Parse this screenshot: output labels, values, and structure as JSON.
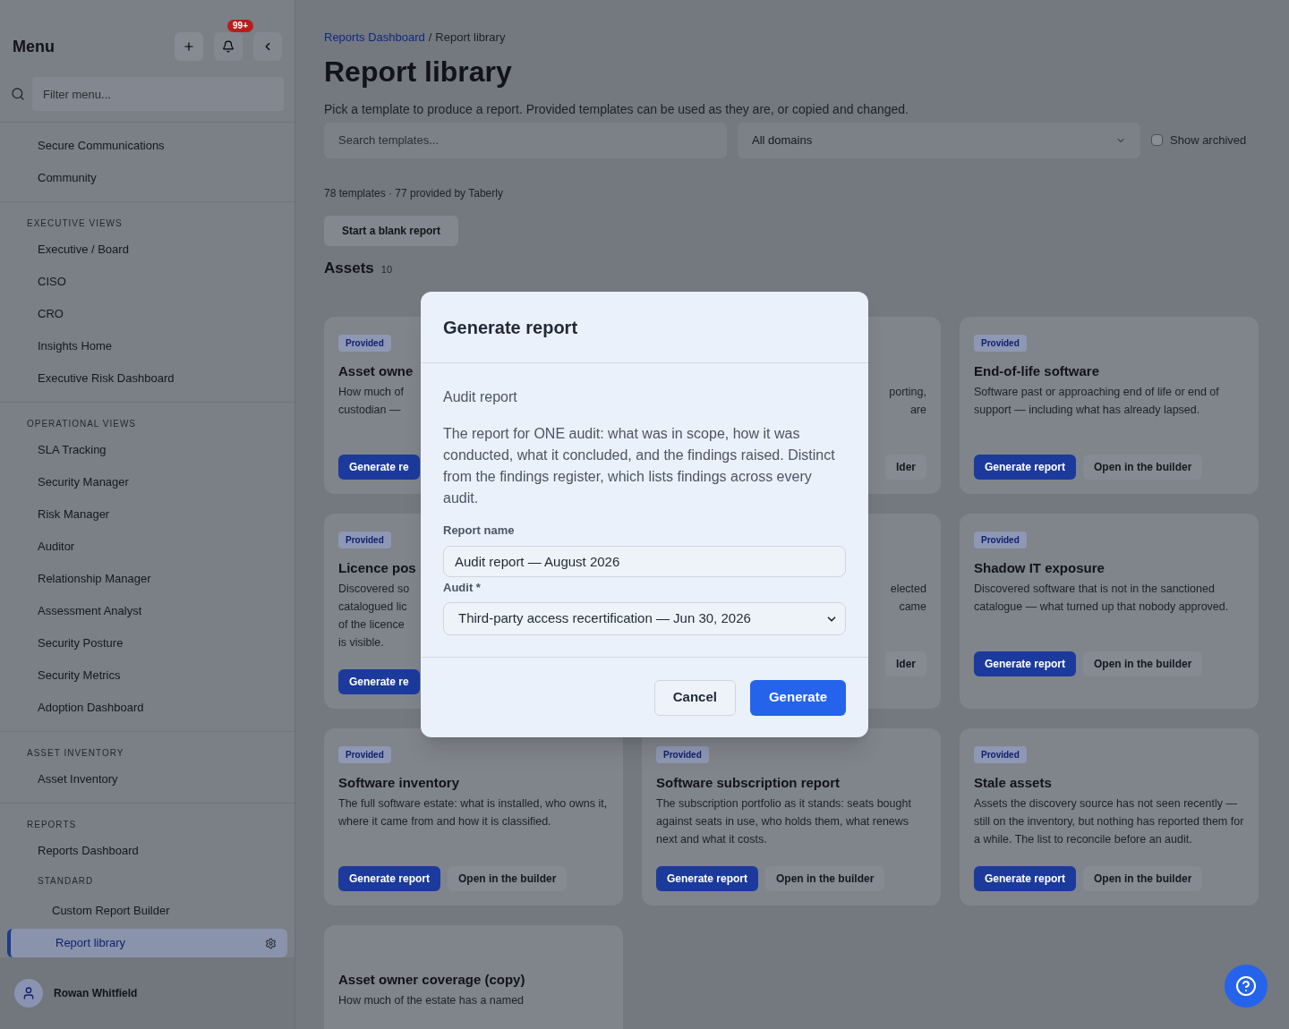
{
  "sidebar": {
    "title": "Menu",
    "notification_badge": "99+",
    "filter": {
      "placeholder": "Filter menu..."
    },
    "sections": [
      {
        "items": [
          {
            "label": "Secure Communications",
            "selected": false
          },
          {
            "label": "Community",
            "selected": false
          }
        ]
      },
      {
        "heading": "EXECUTIVE VIEWS",
        "items": [
          {
            "label": "Executive / Board",
            "selected": false
          },
          {
            "label": "CISO",
            "selected": false
          },
          {
            "label": "CRO",
            "selected": false
          },
          {
            "label": "Insights Home",
            "selected": false
          },
          {
            "label": "Executive Risk Dashboard",
            "selected": false
          }
        ]
      },
      {
        "heading": "OPERATIONAL VIEWS",
        "items": [
          {
            "label": "SLA Tracking",
            "selected": false
          },
          {
            "label": "Security Manager",
            "selected": false
          },
          {
            "label": "Risk Manager",
            "selected": false
          },
          {
            "label": "Auditor",
            "selected": false
          },
          {
            "label": "Relationship Manager",
            "selected": false
          },
          {
            "label": "Assessment Analyst",
            "selected": false
          },
          {
            "label": "Security Posture",
            "selected": false
          },
          {
            "label": "Security Metrics",
            "selected": false
          },
          {
            "label": "Adoption Dashboard",
            "selected": false
          }
        ]
      },
      {
        "heading": "ASSET INVENTORY",
        "items": [
          {
            "label": "Asset Inventory",
            "selected": false
          }
        ]
      },
      {
        "heading": "REPORTS",
        "items": [
          {
            "label": "Reports Dashboard",
            "selected": false
          },
          {
            "label": "STANDARD",
            "kind": "subheading",
            "children": [
              {
                "label": "Custom Report Builder",
                "selected": false
              },
              {
                "label": "Report library",
                "selected": true
              }
            ]
          }
        ]
      }
    ],
    "user": {
      "name": "Rowan Whitfield"
    }
  },
  "breadcrumb": [
    {
      "label": "Reports Dashboard",
      "kind": "link"
    },
    {
      "label": "/",
      "kind": "separator"
    },
    {
      "label": "Report library",
      "kind": "current"
    }
  ],
  "page": {
    "title": "Report library",
    "description": "Pick a template to produce a report. Provided templates can be used as they are, or copied and changed.",
    "search": {
      "placeholder": "Search templates..."
    },
    "domain_select": {
      "value": "All domains"
    },
    "show_archived": {
      "label": "Show archived",
      "checked": false
    },
    "count": "78 templates · 77 provided by Taberly",
    "blank_button": "Start a blank report"
  },
  "section": {
    "title": "Assets",
    "count": "10"
  },
  "cards": [
    {
      "badge": "Provided",
      "title": "Asset owne",
      "description_lines": [
        "How much of",
        "custodian —"
      ],
      "buttons": [
        {
          "label": "Generate re",
          "kind": "primary"
        }
      ]
    },
    {
      "description_lines": [
        "porting,",
        "are"
      ],
      "buttons": [
        {
          "label": "lder",
          "kind": "secondary"
        }
      ]
    },
    {
      "badge": "Provided",
      "title": "End-of-life software",
      "description": "Software past or approaching end of life or end of support — including what has already lapsed.",
      "buttons": [
        {
          "label": "Generate report",
          "kind": "primary"
        },
        {
          "label": "Open in the builder",
          "kind": "secondary"
        }
      ]
    },
    {
      "badge": "Provided",
      "title": "Licence pos",
      "description_lines": [
        "Discovered so",
        "catalogued lic",
        "of the licence",
        "is visible."
      ],
      "buttons": [
        {
          "label": "Generate re",
          "kind": "primary"
        }
      ]
    },
    {
      "description_lines": [
        "elected",
        "came"
      ],
      "buttons": [
        {
          "label": "lder",
          "kind": "secondary"
        }
      ]
    },
    {
      "badge": "Provided",
      "title": "Shadow IT exposure",
      "description": "Discovered software that is not in the sanctioned catalogue — what turned up that nobody approved.",
      "buttons": [
        {
          "label": "Generate report",
          "kind": "primary"
        },
        {
          "label": "Open in the builder",
          "kind": "secondary"
        }
      ]
    },
    {
      "badge": "Provided",
      "title": "Software inventory",
      "description": "The full software estate: what is installed, who owns it, where it came from and how it is classified.",
      "buttons": [
        {
          "label": "Generate report",
          "kind": "primary"
        },
        {
          "label": "Open in the builder",
          "kind": "secondary"
        }
      ]
    },
    {
      "badge": "Provided",
      "title": "Software subscription report",
      "description": "The subscription portfolio as it stands: seats bought against seats in use, who holds them, what renews next and what it costs.",
      "buttons": [
        {
          "label": "Generate report",
          "kind": "primary"
        },
        {
          "label": "Open in the builder",
          "kind": "secondary"
        }
      ]
    },
    {
      "badge": "Provided",
      "title": "Stale assets",
      "description": "Assets the discovery source has not seen recently — still on the inventory, but nothing has reported them for a while. The list to reconcile before an audit.",
      "buttons": [
        {
          "label": "Generate report",
          "kind": "primary"
        },
        {
          "label": "Open in the builder",
          "kind": "secondary"
        }
      ]
    },
    {
      "title": "Asset owner coverage (copy)",
      "description": "How much of the estate has a named"
    }
  ],
  "dialog": {
    "title": "Generate report",
    "subtitle": "Audit report",
    "description": "The report for ONE audit: what was in scope, how it was conducted, what it concluded, and the findings raised. Distinct from the findings register, which lists findings across every audit.",
    "fields": [
      {
        "kind": "text",
        "label": "Report name",
        "value": "Audit report — August 2026"
      },
      {
        "kind": "select",
        "label": "Audit *",
        "value": "Third-party access recertification — Jun 30, 2026"
      }
    ],
    "buttons": [
      {
        "label": "Cancel",
        "kind": "secondary"
      },
      {
        "label": "Generate",
        "kind": "primary"
      }
    ]
  }
}
